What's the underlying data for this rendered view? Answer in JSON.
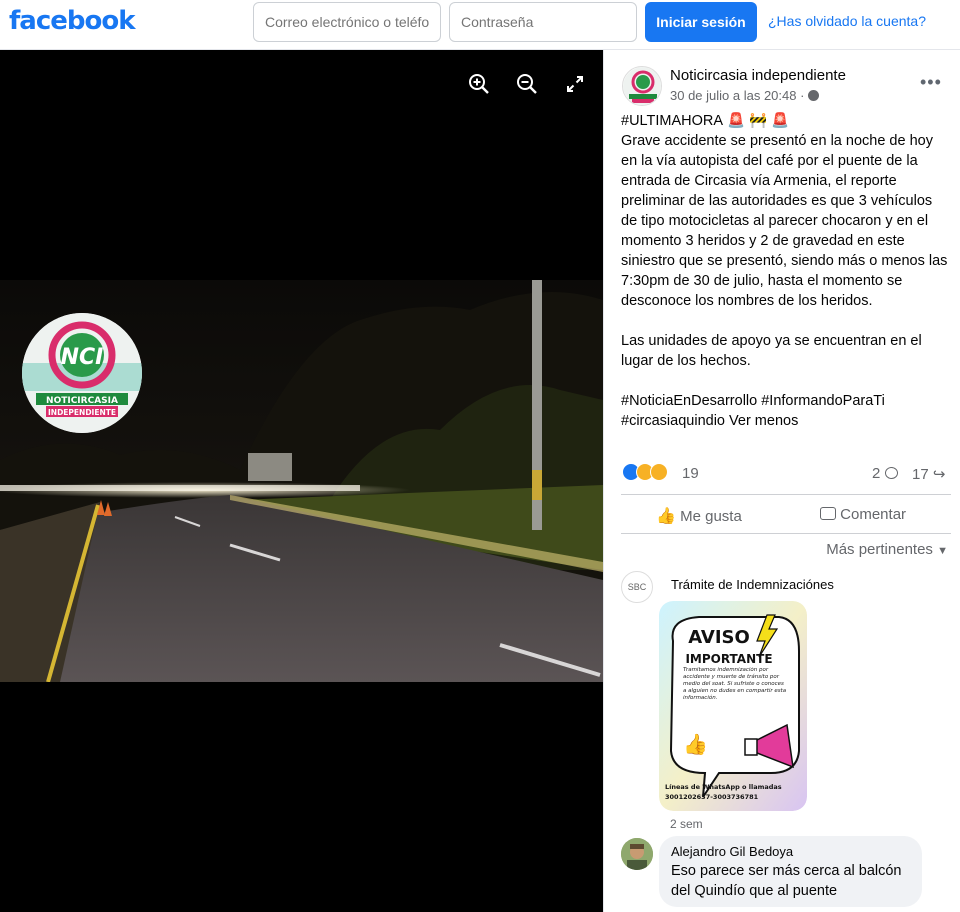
{
  "topbar": {
    "logo": "facebook",
    "email_placeholder": "Correo electrónico o teléfono",
    "password_placeholder": "Contraseña",
    "login_label": "Iniciar sesión",
    "forgot_label": "¿Has olvidado la cuenta?"
  },
  "media": {
    "tools": [
      "zoom-in-icon",
      "zoom-out-icon",
      "fullscreen-icon"
    ],
    "watermark": {
      "badge": "NCI",
      "line1": "NOTICIRCASIA",
      "line2": "INDEPENDIENTE"
    }
  },
  "post": {
    "page_name": "Noticircasia independiente",
    "time": "30 de julio a las 20:48 · ",
    "text": "#ULTIMAHORA 🚨 🚧 🚨\nGrave accidente se presentó en la noche de hoy en la vía autopista del café por el puente de la entrada de Circasia vía Armenia, el reporte preliminar de las autoridades es que 3 vehículos de tipo motocicletas al parecer chocaron y en el momento 3 heridos y 2 de gravedad en este siniestro que se presentó, siendo más o menos las 7:30pm de 30 de julio, hasta el momento se desconoce los nombres de los heridos.\n\nLas unidades de apoyo ya se encuentran en el lugar de los hechos.\n\n#NoticiaEnDesarrollo #InformandoParaTi #circasiaquindio Ver menos",
    "reactions_count": "19",
    "comments_count": "2",
    "shares_count": "17",
    "like_label": "Me gusta",
    "comment_label": "Comentar",
    "sort_label": "Más pertinentes"
  },
  "comments": [
    {
      "name": "Trámite de Indemnizaciónes",
      "avatar_text": "SBC",
      "ad": {
        "title1": "AVISO",
        "title2": "IMPORTANTE",
        "body": "Tramitamos indemnización por accidente y muerte de tránsito por medio del soat. Si sufriste o conoces a alguien no dudes en compartir esta información.",
        "footer1": "Líneas de WhatsApp o llamadas",
        "footer2": "3001202637-3003736781"
      },
      "time": "2 sem"
    },
    {
      "name": "Alejandro Gil Bedoya",
      "text": "Eso parece ser más cerca al balcón del Quindío que al puente"
    }
  ],
  "colors": {
    "brand": "#1877f2",
    "secondary_text": "#65676b",
    "bubble": "#f0f2f5"
  }
}
